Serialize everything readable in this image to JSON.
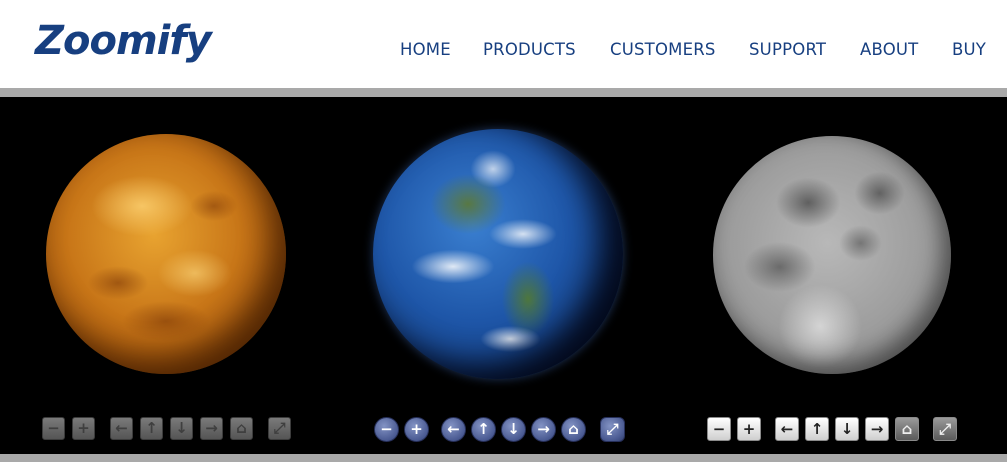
{
  "brand": {
    "logo_text": "Zoomify",
    "logo_color": "#173f80"
  },
  "nav": {
    "items": [
      {
        "label": "HOME"
      },
      {
        "label": "PRODUCTS"
      },
      {
        "label": "CUSTOMERS"
      },
      {
        "label": "SUPPORT"
      },
      {
        "label": "ABOUT"
      },
      {
        "label": "BUY"
      }
    ],
    "color": "#173f80"
  },
  "viewers": [
    {
      "subject": "Venus",
      "toolbar_style": "grey-square",
      "buttons": [
        "zoom-out",
        "zoom-in",
        "pan-left",
        "pan-up",
        "pan-down",
        "pan-right",
        "home",
        "fullscreen"
      ],
      "glyphs": [
        "−",
        "+",
        "←",
        "↑",
        "↓",
        "→",
        "⌂",
        "⤢"
      ]
    },
    {
      "subject": "Earth",
      "toolbar_style": "blue-round",
      "buttons": [
        "zoom-out",
        "zoom-in",
        "pan-left",
        "pan-up",
        "pan-down",
        "pan-right",
        "home",
        "fullscreen"
      ],
      "glyphs": [
        "−",
        "+",
        "←",
        "↑",
        "↓",
        "→",
        "⌂",
        "⤢"
      ]
    },
    {
      "subject": "Moon",
      "toolbar_style": "white-square",
      "buttons": [
        "zoom-out",
        "zoom-in",
        "pan-left",
        "pan-up",
        "pan-down",
        "pan-right",
        "home",
        "fullscreen"
      ],
      "glyphs": [
        "−",
        "+",
        "←",
        "↑",
        "↓",
        "→",
        "⌂",
        "⤢"
      ]
    }
  ],
  "colors": {
    "stage_background": "#000000",
    "separator": "#a9a9a9"
  }
}
